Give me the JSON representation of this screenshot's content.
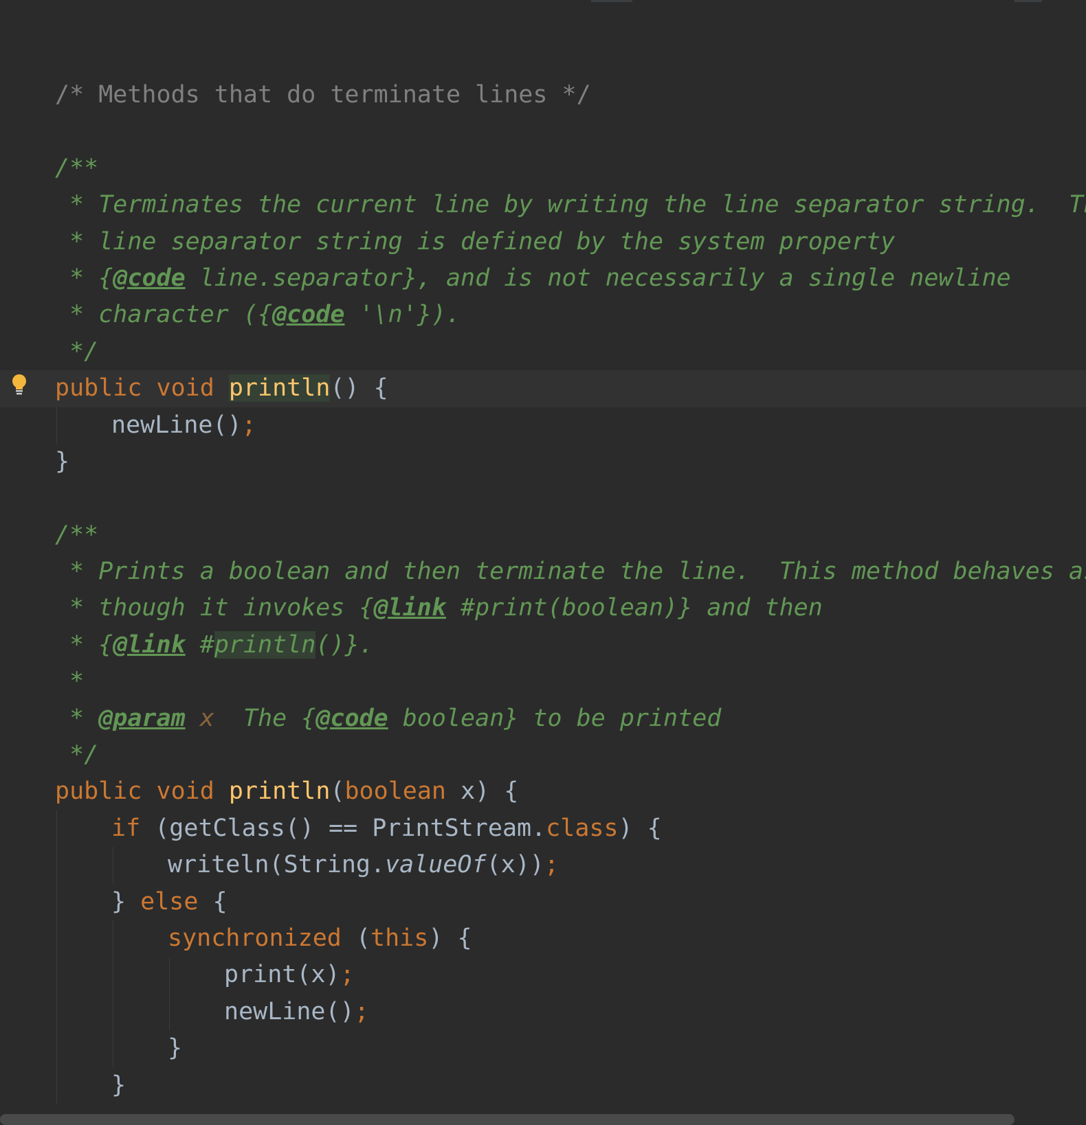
{
  "editor": {
    "language": "Java",
    "theme": "Darcula",
    "colors": {
      "background": "#2b2b2b",
      "caret_line": "#323232",
      "plain": "#a9b7c6",
      "comment": "#808080",
      "doc_comment": "#629755",
      "keyword": "#cc7832",
      "method_declaration": "#ffc66d",
      "identifier_highlight": "#344134",
      "intention_bulb": "#f4b73d"
    },
    "intention_icon": "lightbulb-icon",
    "lines": [
      {
        "indent": 0,
        "tokens": [
          {
            "t": "/* Methods that do terminate lines */",
            "c": "comment"
          }
        ]
      },
      {
        "indent": 0,
        "tokens": []
      },
      {
        "indent": 0,
        "tokens": [
          {
            "t": "/**",
            "c": "doc"
          }
        ]
      },
      {
        "indent": 0,
        "tokens": [
          {
            "t": " * Terminates the current line by writing the line separator string.  The",
            "c": "doc"
          }
        ]
      },
      {
        "indent": 0,
        "tokens": [
          {
            "t": " * line separator string is defined by the system property",
            "c": "doc"
          }
        ]
      },
      {
        "indent": 0,
        "tokens": [
          {
            "t": " * {",
            "c": "doc"
          },
          {
            "t": "@code",
            "c": "doctag"
          },
          {
            "t": " line.separator}, and is not necessarily a single newline",
            "c": "doc"
          }
        ]
      },
      {
        "indent": 0,
        "tokens": [
          {
            "t": " * character ({",
            "c": "doc"
          },
          {
            "t": "@code",
            "c": "doctag"
          },
          {
            "t": " '\\n'}).",
            "c": "doc"
          }
        ]
      },
      {
        "indent": 0,
        "tokens": [
          {
            "t": " */",
            "c": "doc"
          }
        ]
      },
      {
        "indent": 0,
        "caret": true,
        "bulb": true,
        "tokens": [
          {
            "t": "public",
            "c": "keyword"
          },
          {
            "t": " ",
            "c": "plain"
          },
          {
            "t": "void",
            "c": "keyword"
          },
          {
            "t": " ",
            "c": "plain"
          },
          {
            "t": "println",
            "c": "method",
            "hl": true
          },
          {
            "t": "() {",
            "c": "plain"
          }
        ]
      },
      {
        "indent": 4,
        "tokens": [
          {
            "t": "newLine()",
            "c": "plain"
          },
          {
            "t": ";",
            "c": "semicolon"
          }
        ]
      },
      {
        "indent": 0,
        "tokens": [
          {
            "t": "}",
            "c": "plain"
          }
        ]
      },
      {
        "indent": 0,
        "tokens": []
      },
      {
        "indent": 0,
        "tokens": [
          {
            "t": "/**",
            "c": "doc"
          }
        ]
      },
      {
        "indent": 0,
        "tokens": [
          {
            "t": " * Prints a boolean and then terminate the line.  This method behaves as",
            "c": "doc"
          }
        ]
      },
      {
        "indent": 0,
        "tokens": [
          {
            "t": " * though it invokes {",
            "c": "doc"
          },
          {
            "t": "@link",
            "c": "doctag"
          },
          {
            "t": " #print(boolean)} and then",
            "c": "doc"
          }
        ]
      },
      {
        "indent": 0,
        "tokens": [
          {
            "t": " * {",
            "c": "doc"
          },
          {
            "t": "@link",
            "c": "doctag"
          },
          {
            "t": " #",
            "c": "doc"
          },
          {
            "t": "println",
            "c": "doc",
            "hl": true
          },
          {
            "t": "()}.",
            "c": "doc"
          }
        ]
      },
      {
        "indent": 0,
        "tokens": [
          {
            "t": " *",
            "c": "doc"
          }
        ]
      },
      {
        "indent": 0,
        "tokens": [
          {
            "t": " * ",
            "c": "doc"
          },
          {
            "t": "@param",
            "c": "doctag"
          },
          {
            "t": " ",
            "c": "doc"
          },
          {
            "t": "x",
            "c": "docparam"
          },
          {
            "t": "  The {",
            "c": "doc"
          },
          {
            "t": "@code",
            "c": "doctag"
          },
          {
            "t": " boolean} to be printed",
            "c": "doc"
          }
        ]
      },
      {
        "indent": 0,
        "tokens": [
          {
            "t": " */",
            "c": "doc"
          }
        ]
      },
      {
        "indent": 0,
        "tokens": [
          {
            "t": "public",
            "c": "keyword"
          },
          {
            "t": " ",
            "c": "plain"
          },
          {
            "t": "void",
            "c": "keyword"
          },
          {
            "t": " ",
            "c": "plain"
          },
          {
            "t": "println",
            "c": "method"
          },
          {
            "t": "(",
            "c": "plain"
          },
          {
            "t": "boolean",
            "c": "keyword"
          },
          {
            "t": " x) {",
            "c": "plain"
          }
        ]
      },
      {
        "indent": 4,
        "tokens": [
          {
            "t": "if",
            "c": "keyword"
          },
          {
            "t": " (getClass() == PrintStream.",
            "c": "plain"
          },
          {
            "t": "class",
            "c": "keyword"
          },
          {
            "t": ") {",
            "c": "plain"
          }
        ]
      },
      {
        "indent": 8,
        "tokens": [
          {
            "t": "writeln(String.",
            "c": "plain"
          },
          {
            "t": "valueOf",
            "c": "static"
          },
          {
            "t": "(x))",
            "c": "plain"
          },
          {
            "t": ";",
            "c": "semicolon"
          }
        ]
      },
      {
        "indent": 4,
        "tokens": [
          {
            "t": "} ",
            "c": "plain"
          },
          {
            "t": "else",
            "c": "keyword"
          },
          {
            "t": " {",
            "c": "plain"
          }
        ]
      },
      {
        "indent": 8,
        "tokens": [
          {
            "t": "synchronized",
            "c": "keyword"
          },
          {
            "t": " (",
            "c": "plain"
          },
          {
            "t": "this",
            "c": "keyword"
          },
          {
            "t": ") {",
            "c": "plain"
          }
        ]
      },
      {
        "indent": 12,
        "tokens": [
          {
            "t": "print(x)",
            "c": "plain"
          },
          {
            "t": ";",
            "c": "semicolon"
          }
        ]
      },
      {
        "indent": 12,
        "tokens": [
          {
            "t": "newLine()",
            "c": "plain"
          },
          {
            "t": ";",
            "c": "semicolon"
          }
        ]
      },
      {
        "indent": 8,
        "tokens": [
          {
            "t": "}",
            "c": "plain"
          }
        ]
      },
      {
        "indent": 4,
        "tokens": [
          {
            "t": "}",
            "c": "plain"
          }
        ]
      }
    ]
  }
}
